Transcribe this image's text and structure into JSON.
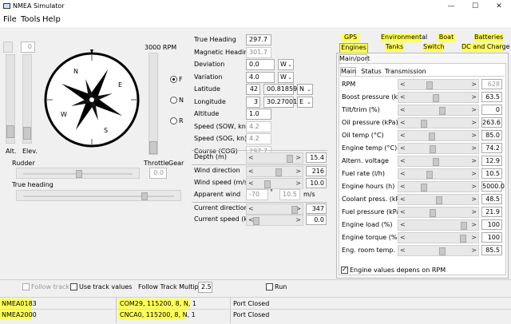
{
  "window": {
    "title": "NMEA Simulator",
    "controls": [
      "—",
      "☐",
      "✕"
    ]
  },
  "menu": [
    "File",
    "Tools",
    "Help"
  ],
  "left": {
    "alt_label": "Alt.",
    "elev_label": "Elev.",
    "alt_spin": "0",
    "rpm_label": "3000 RPM",
    "radio_options": [
      "F",
      "N",
      "R"
    ],
    "selected_radio": "F",
    "rudder_label": "Rudder",
    "throttle_label": "Throttle",
    "gear_label": "Gear",
    "gear_value": "0.0",
    "true_heading_label": "True heading",
    "compass_labels": [
      "N",
      "E",
      "S",
      "W"
    ]
  },
  "middle": {
    "fields": [
      {
        "label": "True Heading",
        "value": "297.7",
        "dim": false
      },
      {
        "label": "Magnetic Heading",
        "value": "301.7",
        "dim": true
      },
      {
        "label": "Deviation",
        "value": "0.0",
        "dim": false,
        "combo": "W"
      },
      {
        "label": "Variation",
        "value": "4.0",
        "dim": false,
        "combo": "W"
      },
      {
        "label": "Latitude",
        "deg": "42",
        "min": "00.81859",
        "combo": "N"
      },
      {
        "label": "Longitude",
        "deg": "3",
        "min": "30.27001",
        "combo": "E"
      },
      {
        "label": "Altitude",
        "value": "1.0",
        "dim": false
      },
      {
        "label": "Speed (SOW, kn)",
        "value": "4.2",
        "dim": true
      },
      {
        "label": "Speed (SOG, kn)",
        "value": "4.2",
        "dim": true
      },
      {
        "label": "Course (COG)",
        "value": "297.7",
        "dim": true
      }
    ],
    "depth": {
      "label": "Depth (m)",
      "value": "15.4"
    },
    "wind_direction": {
      "label": "Wind direction",
      "value": "216"
    },
    "wind_speed": {
      "label": "Wind speed (m/s)",
      "value": "10.0"
    },
    "apparent_wind": {
      "label": "Apparent wind",
      "angle": "-70",
      "deg_sign": "°",
      "speed": "10.5",
      "unit": "m/s"
    },
    "current_direction": {
      "label": "Current direction",
      "value": "347"
    },
    "current_speed": {
      "label": "Current speed (kn)",
      "value": "0.0"
    }
  },
  "tabs": {
    "row1": [
      "GPS",
      "Environmental",
      "Boat",
      "Batteries"
    ],
    "row2": [
      "Engines",
      "Tanks",
      "Switch",
      "DC and Charge"
    ],
    "active_row2": "Engines",
    "sub": [
      "Main/port"
    ],
    "inner": [
      "Main",
      "Status",
      "Transmission"
    ],
    "engine_rows": [
      {
        "label": "RPM",
        "value": "628",
        "dim": true,
        "pos": 0.35
      },
      {
        "label": "Boost pressure (kPa)",
        "value": "63.5",
        "dim": false,
        "pos": 0.45
      },
      {
        "label": "Tilt/trim (%)",
        "value": "0",
        "dim": false,
        "pos": 0.55
      },
      {
        "label": "Oil pressure (kPa)",
        "value": "263.6",
        "dim": false,
        "pos": 0.25
      },
      {
        "label": "Oil temp (°C)",
        "value": "85.0",
        "dim": false,
        "pos": 0.38
      },
      {
        "label": "Engine temp (°C)",
        "value": "74.2",
        "dim": false,
        "pos": 0.4
      },
      {
        "label": "Altern. voltage",
        "value": "12.9",
        "dim": false,
        "pos": 0.45
      },
      {
        "label": "Fuel rate (l/h)",
        "value": "10.5",
        "dim": false,
        "pos": 0.35
      },
      {
        "label": "Engine hours (h)",
        "value": "5000.0",
        "dim": false,
        "pos": 0.25
      },
      {
        "label": "Coolant press. (kPa)",
        "value": "48.5",
        "dim": false,
        "pos": 0.5
      },
      {
        "label": "Fuel pressure (kPa)",
        "value": "21.9",
        "dim": false,
        "pos": 0.4
      },
      {
        "label": "Engine load (%)",
        "value": "100",
        "dim": false,
        "pos": 0.9
      },
      {
        "label": "Engine torque (%)",
        "value": "100",
        "dim": false,
        "pos": 0.88
      },
      {
        "label": "Eng. room temp. (°C)",
        "value": "85.5",
        "dim": false,
        "pos": 0.55
      }
    ],
    "depends_label": "Engine values depens on RPM",
    "depends_checked": true
  },
  "bottom": {
    "follow_track": "Follow track",
    "use_track_values": "Use track values",
    "follow_multiplier_label": "Follow Track Multiplier",
    "follow_multiplier_value": "2.5",
    "run_label": "Run"
  },
  "status": [
    {
      "name": "NMEA0183",
      "port": "COM29, 115200, 8, N, 1",
      "state": "Port Closed"
    },
    {
      "name": "NMEA2000",
      "port": "CNCA0, 115200, 8, N, 1",
      "state": "Port Closed"
    }
  ],
  "colors": {
    "highlight": "#ffff55",
    "window_bg": "#f0f0f0"
  }
}
